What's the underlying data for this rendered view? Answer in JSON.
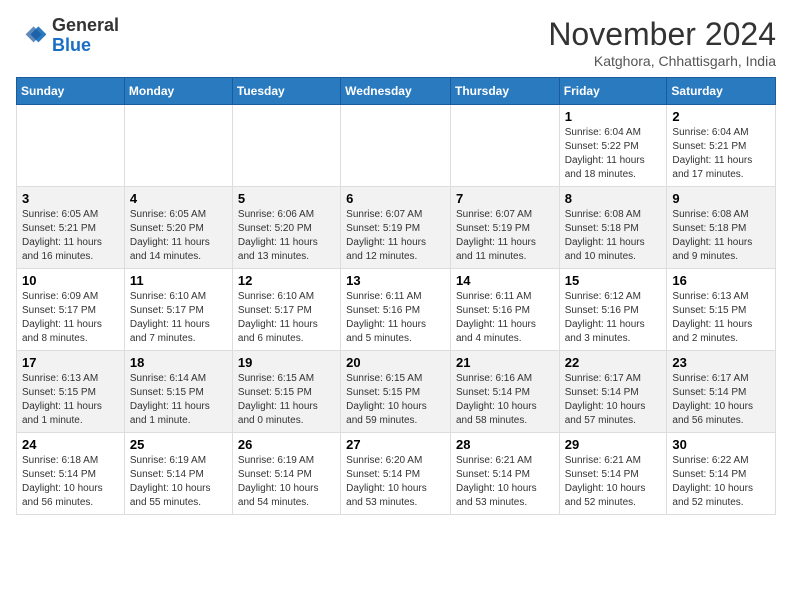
{
  "header": {
    "logo_general": "General",
    "logo_blue": "Blue",
    "month": "November 2024",
    "location": "Katghora, Chhattisgarh, India"
  },
  "days_of_week": [
    "Sunday",
    "Monday",
    "Tuesday",
    "Wednesday",
    "Thursday",
    "Friday",
    "Saturday"
  ],
  "weeks": [
    [
      {
        "day": "",
        "info": ""
      },
      {
        "day": "",
        "info": ""
      },
      {
        "day": "",
        "info": ""
      },
      {
        "day": "",
        "info": ""
      },
      {
        "day": "",
        "info": ""
      },
      {
        "day": "1",
        "info": "Sunrise: 6:04 AM\nSunset: 5:22 PM\nDaylight: 11 hours and 18 minutes."
      },
      {
        "day": "2",
        "info": "Sunrise: 6:04 AM\nSunset: 5:21 PM\nDaylight: 11 hours and 17 minutes."
      }
    ],
    [
      {
        "day": "3",
        "info": "Sunrise: 6:05 AM\nSunset: 5:21 PM\nDaylight: 11 hours and 16 minutes."
      },
      {
        "day": "4",
        "info": "Sunrise: 6:05 AM\nSunset: 5:20 PM\nDaylight: 11 hours and 14 minutes."
      },
      {
        "day": "5",
        "info": "Sunrise: 6:06 AM\nSunset: 5:20 PM\nDaylight: 11 hours and 13 minutes."
      },
      {
        "day": "6",
        "info": "Sunrise: 6:07 AM\nSunset: 5:19 PM\nDaylight: 11 hours and 12 minutes."
      },
      {
        "day": "7",
        "info": "Sunrise: 6:07 AM\nSunset: 5:19 PM\nDaylight: 11 hours and 11 minutes."
      },
      {
        "day": "8",
        "info": "Sunrise: 6:08 AM\nSunset: 5:18 PM\nDaylight: 11 hours and 10 minutes."
      },
      {
        "day": "9",
        "info": "Sunrise: 6:08 AM\nSunset: 5:18 PM\nDaylight: 11 hours and 9 minutes."
      }
    ],
    [
      {
        "day": "10",
        "info": "Sunrise: 6:09 AM\nSunset: 5:17 PM\nDaylight: 11 hours and 8 minutes."
      },
      {
        "day": "11",
        "info": "Sunrise: 6:10 AM\nSunset: 5:17 PM\nDaylight: 11 hours and 7 minutes."
      },
      {
        "day": "12",
        "info": "Sunrise: 6:10 AM\nSunset: 5:17 PM\nDaylight: 11 hours and 6 minutes."
      },
      {
        "day": "13",
        "info": "Sunrise: 6:11 AM\nSunset: 5:16 PM\nDaylight: 11 hours and 5 minutes."
      },
      {
        "day": "14",
        "info": "Sunrise: 6:11 AM\nSunset: 5:16 PM\nDaylight: 11 hours and 4 minutes."
      },
      {
        "day": "15",
        "info": "Sunrise: 6:12 AM\nSunset: 5:16 PM\nDaylight: 11 hours and 3 minutes."
      },
      {
        "day": "16",
        "info": "Sunrise: 6:13 AM\nSunset: 5:15 PM\nDaylight: 11 hours and 2 minutes."
      }
    ],
    [
      {
        "day": "17",
        "info": "Sunrise: 6:13 AM\nSunset: 5:15 PM\nDaylight: 11 hours and 1 minute."
      },
      {
        "day": "18",
        "info": "Sunrise: 6:14 AM\nSunset: 5:15 PM\nDaylight: 11 hours and 1 minute."
      },
      {
        "day": "19",
        "info": "Sunrise: 6:15 AM\nSunset: 5:15 PM\nDaylight: 11 hours and 0 minutes."
      },
      {
        "day": "20",
        "info": "Sunrise: 6:15 AM\nSunset: 5:15 PM\nDaylight: 10 hours and 59 minutes."
      },
      {
        "day": "21",
        "info": "Sunrise: 6:16 AM\nSunset: 5:14 PM\nDaylight: 10 hours and 58 minutes."
      },
      {
        "day": "22",
        "info": "Sunrise: 6:17 AM\nSunset: 5:14 PM\nDaylight: 10 hours and 57 minutes."
      },
      {
        "day": "23",
        "info": "Sunrise: 6:17 AM\nSunset: 5:14 PM\nDaylight: 10 hours and 56 minutes."
      }
    ],
    [
      {
        "day": "24",
        "info": "Sunrise: 6:18 AM\nSunset: 5:14 PM\nDaylight: 10 hours and 56 minutes."
      },
      {
        "day": "25",
        "info": "Sunrise: 6:19 AM\nSunset: 5:14 PM\nDaylight: 10 hours and 55 minutes."
      },
      {
        "day": "26",
        "info": "Sunrise: 6:19 AM\nSunset: 5:14 PM\nDaylight: 10 hours and 54 minutes."
      },
      {
        "day": "27",
        "info": "Sunrise: 6:20 AM\nSunset: 5:14 PM\nDaylight: 10 hours and 53 minutes."
      },
      {
        "day": "28",
        "info": "Sunrise: 6:21 AM\nSunset: 5:14 PM\nDaylight: 10 hours and 53 minutes."
      },
      {
        "day": "29",
        "info": "Sunrise: 6:21 AM\nSunset: 5:14 PM\nDaylight: 10 hours and 52 minutes."
      },
      {
        "day": "30",
        "info": "Sunrise: 6:22 AM\nSunset: 5:14 PM\nDaylight: 10 hours and 52 minutes."
      }
    ]
  ]
}
